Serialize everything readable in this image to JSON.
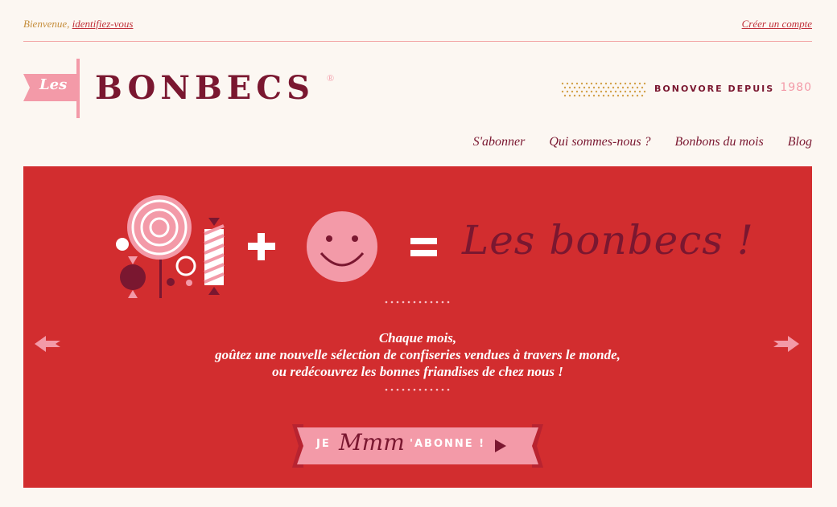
{
  "topbar": {
    "welcome_prefix": "Bienvenue,",
    "login_link": "identifiez-vous",
    "create_account": "Créer un compte"
  },
  "logo": {
    "les": "Les",
    "word": "BONBECS",
    "registered": "®"
  },
  "bonovore": {
    "label": "BONOVORE DEPUIS",
    "year": "1980"
  },
  "nav": {
    "items": [
      "S'abonner",
      "Qui sommes-nous ?",
      "Bonbons du mois",
      "Blog"
    ]
  },
  "hero": {
    "script_title": "Les bonbecs !",
    "line1": "Chaque mois,",
    "line2": "goûtez une nouvelle sélection de confiseries vendues à travers le monde,",
    "line3": "ou redécouvrez les bonnes friandises de chez nous !",
    "cta_je": "JE",
    "cta_mmm": "Mmm",
    "cta_abonne": "'ABONNE !"
  },
  "colors": {
    "background": "#fcf7f2",
    "hero_red": "#d22d2f",
    "burgundy": "#7a1730",
    "pink": "#f39aa8",
    "gold": "#c58d3a"
  },
  "icons": {
    "candy_group": "candy-illustration-icon",
    "plus": "plus-icon",
    "smiley": "smiley-icon",
    "equals": "equals-icon",
    "prev": "arrow-left-icon",
    "next": "arrow-right-icon",
    "cta_play": "play-icon"
  }
}
